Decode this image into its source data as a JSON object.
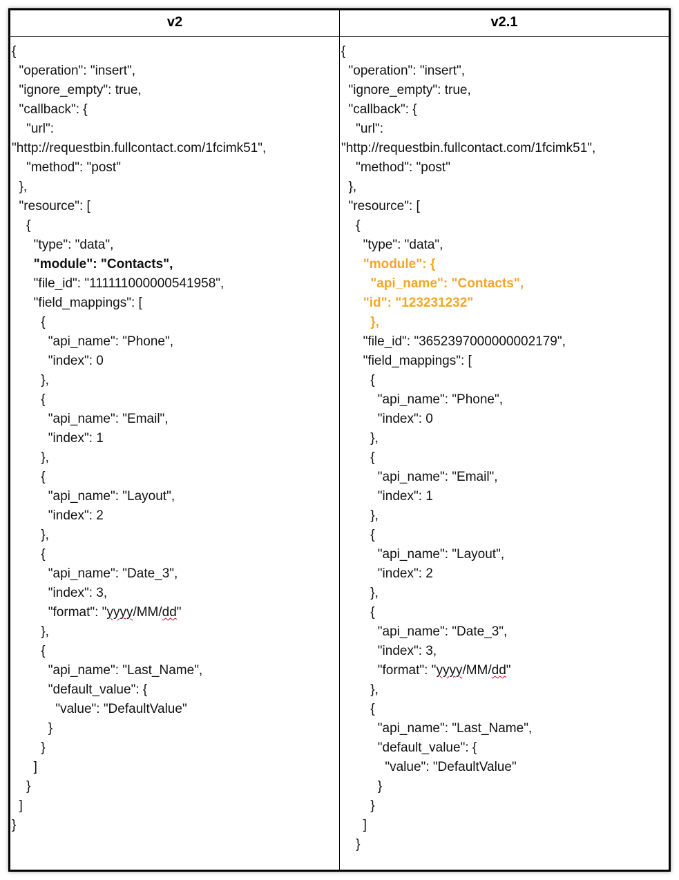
{
  "headers": {
    "left": "v2",
    "right": "v2.1"
  },
  "v2": {
    "l01": "{",
    "l02": "  \"operation\": \"insert\",",
    "l03": "  \"ignore_empty\": true,",
    "l04": "  \"callback\": {",
    "l05": "    \"url\":",
    "l06": "\"http://requestbin.fullcontact.com/1fcimk51\",",
    "l07": "    \"method\": \"post\"",
    "l08": "  },",
    "l09": "  \"resource\": [",
    "l10": "    {",
    "l11": "      \"type\": \"data\",",
    "l12_pre": "      ",
    "l12_bold": "\"module\": \"Contacts\",",
    "l13": "      \"file_id\": \"111111000000541958\",",
    "l14": "      \"field_mappings\": [",
    "l15": "        {",
    "l16": "          \"api_name\": \"Phone\",",
    "l17": "          \"index\": 0",
    "l18": "        },",
    "l19": "        {",
    "l20": "          \"api_name\": \"Email\",",
    "l21": "          \"index\": 1",
    "l22": "        },",
    "l23": "        {",
    "l24": "          \"api_name\": \"Layout\",",
    "l25": "          \"index\": 2",
    "l26": "        },",
    "l27": "        {",
    "l28": "          \"api_name\": \"Date_3\",",
    "l29": "          \"index\": 3,",
    "l30_pre": "          \"format\": \"",
    "l30_s1": "yyyy",
    "l30_m1": "/MM/",
    "l30_s2": "dd",
    "l30_post": "\"",
    "l31": "        },",
    "l32": "        {",
    "l33": "          \"api_name\": \"Last_Name\",",
    "l34": "          \"default_value\": {",
    "l35": "            \"value\": \"DefaultValue\"",
    "l36": "          }",
    "l37": "        }",
    "l38": "      ]",
    "l39": "    }",
    "l40": "  ]",
    "l41": "}"
  },
  "v21": {
    "l01": "{",
    "l02": "  \"operation\": \"insert\",",
    "l03": "  \"ignore_empty\": true,",
    "l04": "  \"callback\": {",
    "l05": "    \"url\":",
    "l06": "\"http://requestbin.fullcontact.com/1fcimk51\",",
    "l07": "    \"method\": \"post\"",
    "l08": "  },",
    "l09": "  \"resource\": [",
    "l10": "    {",
    "l11": "      \"type\": \"data\",",
    "h1_pre": "      ",
    "h1": "\"module\": {",
    "h2_pre": "        ",
    "h2": "\"api_name\": \"Contacts\",",
    "h3_pre": "      ",
    "h3": "\"id\": \"123231232\"",
    "h4_pre": "        ",
    "h4": "},",
    "l13": "      \"file_id\": \"3652397000000002179\",",
    "l14": "      \"field_mappings\": [",
    "l15": "        {",
    "l16": "          \"api_name\": \"Phone\",",
    "l17": "          \"index\": 0",
    "l18": "        },",
    "l19": "        {",
    "l20": "          \"api_name\": \"Email\",",
    "l21": "          \"index\": 1",
    "l22": "        },",
    "l23": "        {",
    "l24": "          \"api_name\": \"Layout\",",
    "l25": "          \"index\": 2",
    "l26": "        },",
    "l27": "        {",
    "l28": "          \"api_name\": \"Date_3\",",
    "l29": "          \"index\": 3,",
    "l30_pre": "          \"format\": \"",
    "l30_s1": "yyyy",
    "l30_m1": "/MM/",
    "l30_s2": "dd",
    "l30_post": "\"",
    "l31": "        },",
    "l32": "        {",
    "l33": "          \"api_name\": \"Last_Name\",",
    "l34": "          \"default_value\": {",
    "l35": "            \"value\": \"DefaultValue\"",
    "l36": "          }",
    "l37": "        }",
    "l38": "      ]",
    "l39": "    }"
  }
}
